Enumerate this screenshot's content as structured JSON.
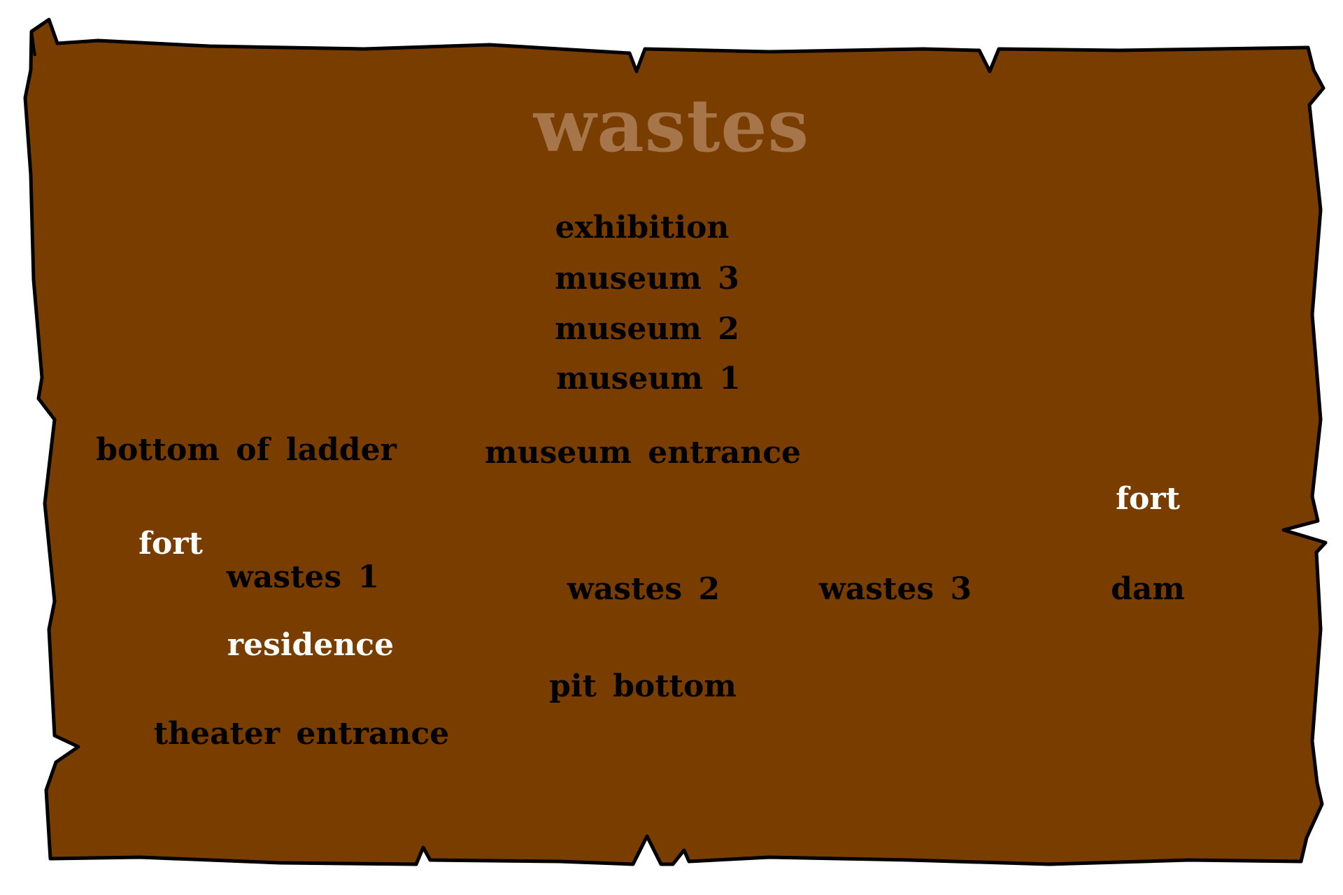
{
  "map": {
    "title": "wastes",
    "colors": {
      "parchment": "#7a3d00",
      "outline": "#000000",
      "title": "#a6764a",
      "location": "#000000",
      "current_location": "#ffffff"
    },
    "locations": {
      "exhibition": "exhibition",
      "museum_3": "museum 3",
      "museum_2": "museum 2",
      "museum_1": "museum 1",
      "bottom_of_ladder": "bottom of ladder",
      "museum_entrance": "museum entrance",
      "fort_right": "fort",
      "fort_left": "fort",
      "wastes_1": "wastes 1",
      "wastes_2": "wastes 2",
      "wastes_3": "wastes 3",
      "dam": "dam",
      "residence": "residence",
      "pit_bottom": "pit bottom",
      "theater_entrance": "theater entrance"
    }
  }
}
